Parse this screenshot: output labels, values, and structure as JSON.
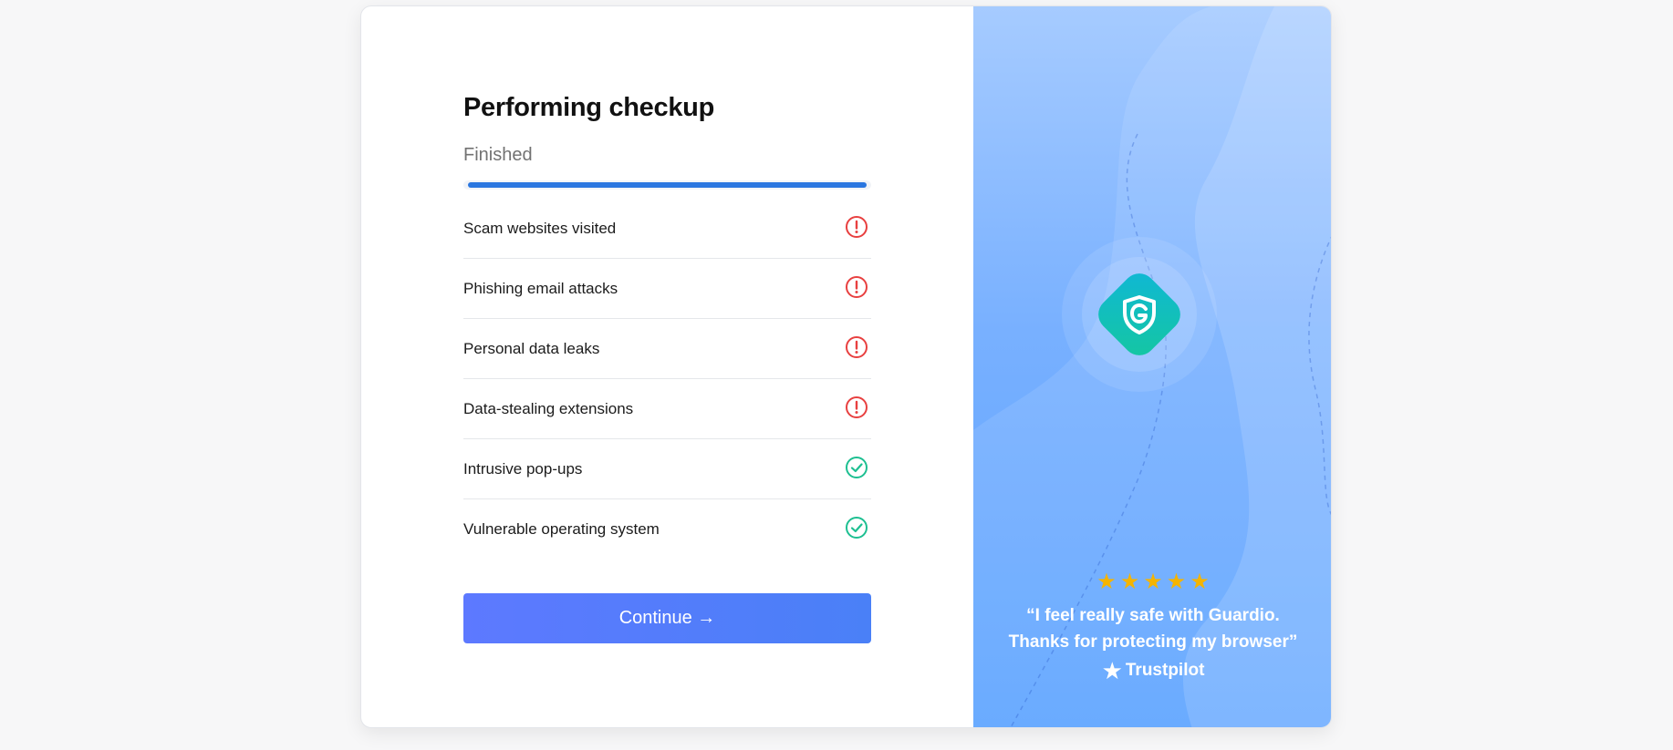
{
  "checkup": {
    "title": "Performing checkup",
    "status": "Finished",
    "progress_fraction": 1.0,
    "progress_color": "#2a76e0",
    "items": [
      {
        "label": "Scam websites visited",
        "state": "warning",
        "icon": "alert-icon"
      },
      {
        "label": "Phishing email attacks",
        "state": "warning",
        "icon": "alert-icon"
      },
      {
        "label": "Personal data leaks",
        "state": "warning",
        "icon": "alert-icon"
      },
      {
        "label": "Data-stealing extensions",
        "state": "warning",
        "icon": "alert-icon"
      },
      {
        "label": "Intrusive pop-ups",
        "state": "ok",
        "icon": "check-icon"
      },
      {
        "label": "Vulnerable operating system",
        "state": "ok",
        "icon": "check-icon"
      }
    ],
    "continue_label": "Continue →",
    "colors": {
      "warning": "#e84040",
      "ok": "#1dbf91",
      "button": "#5479fb"
    }
  },
  "promo": {
    "logo_icon": "guardio-shield-icon",
    "rating_stars": 5,
    "quote": "“I feel really safe with Guardio.\nThanks for protecting my browser”",
    "trust_label": "Trustpilot",
    "colors": {
      "star": "#f5b400",
      "panel_top": "#a6cbff",
      "panel_bottom": "#5aa2ff",
      "logo": "#14c0b8"
    }
  }
}
